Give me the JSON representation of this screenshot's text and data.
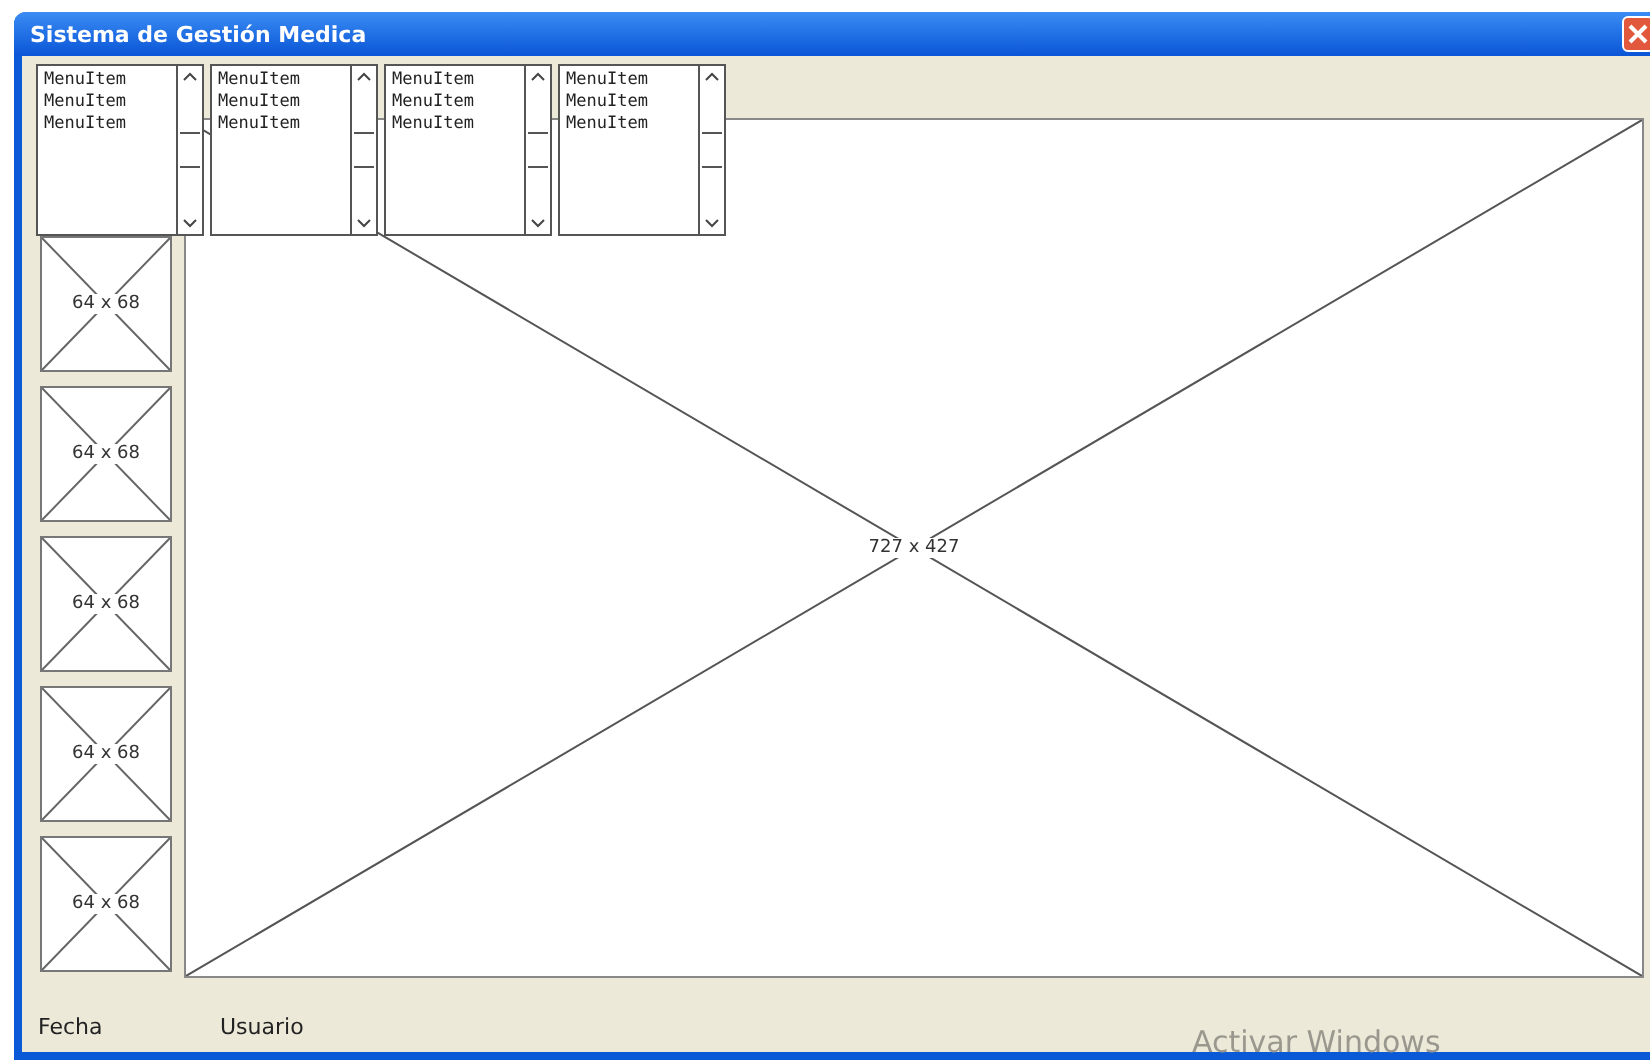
{
  "window": {
    "title": "Sistema de Gestión Medica"
  },
  "menu_lists": [
    {
      "items": [
        "MenuItem",
        "MenuItem",
        "MenuItem"
      ]
    },
    {
      "items": [
        "MenuItem",
        "MenuItem",
        "MenuItem"
      ]
    },
    {
      "items": [
        "MenuItem",
        "MenuItem",
        "MenuItem"
      ]
    },
    {
      "items": [
        "MenuItem",
        "MenuItem",
        "MenuItem"
      ]
    }
  ],
  "thumbnails": [
    {
      "label": "64 x 68"
    },
    {
      "label": "64 x 68"
    },
    {
      "label": "64 x 68"
    },
    {
      "label": "64 x 68"
    },
    {
      "label": "64 x 68"
    }
  ],
  "main_image": {
    "label": "727 x 427"
  },
  "status_bar": {
    "items": [
      "Fecha",
      "Usuario"
    ]
  },
  "system_notice": "Activar Windows"
}
